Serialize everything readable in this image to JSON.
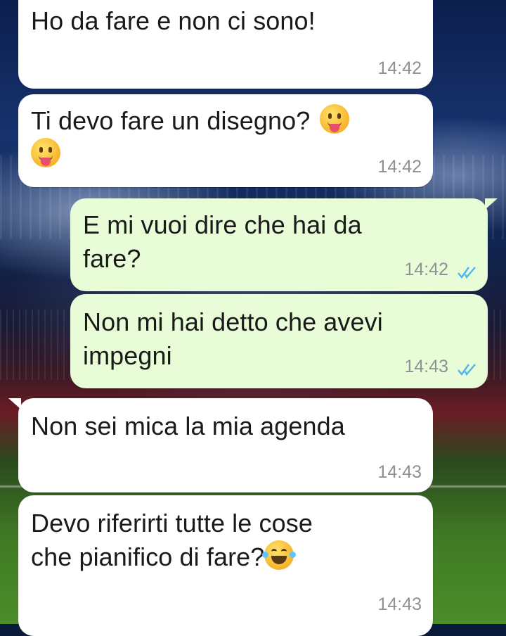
{
  "chat": {
    "messages": [
      {
        "direction": "in",
        "text": "Ho da fare e non ci sono!",
        "time": "14:42"
      },
      {
        "direction": "in",
        "text": "Ti devo fare un disegno?",
        "emoji": "face-with-tongue",
        "emoji2": "face-with-tongue",
        "time": "14:42"
      },
      {
        "direction": "out",
        "text_line1": "E mi vuoi dire che hai da",
        "text_line2": "fare?",
        "time": "14:42",
        "status": "read"
      },
      {
        "direction": "out",
        "text_line1": "Non mi hai detto che avevi",
        "text_line2": "impegni",
        "time": "14:43",
        "status": "read"
      },
      {
        "direction": "in",
        "text": "Non sei mica la mia agenda",
        "time": "14:43"
      },
      {
        "direction": "in",
        "text_line1": "Devo riferirti tutte le cose",
        "text_line2": "che pianifico di fare?",
        "emoji": "face-with-tears-of-joy",
        "time": "14:43"
      }
    ]
  },
  "colors": {
    "incoming_bubble": "#ffffff",
    "outgoing_bubble": "#e7fcd7",
    "read_ticks": "#4fb6ec",
    "timestamp": "#8c9296"
  }
}
